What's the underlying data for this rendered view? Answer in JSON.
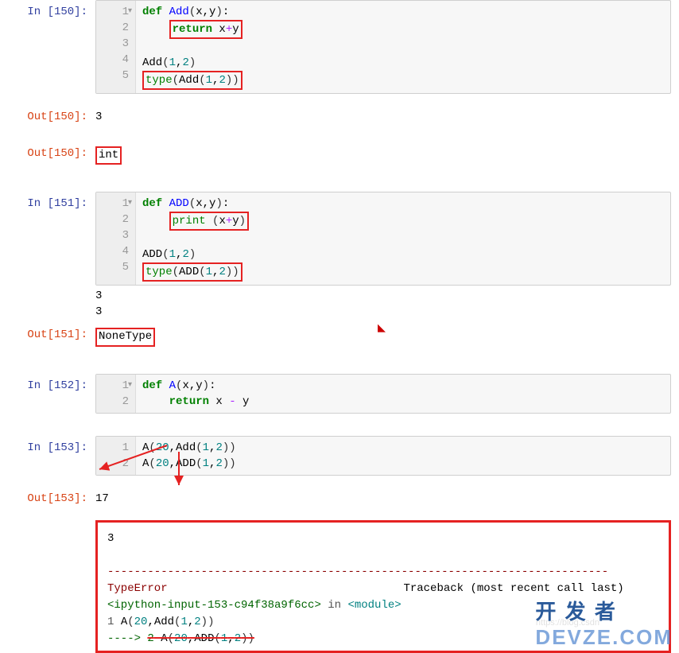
{
  "cells": {
    "c150": {
      "in_prompt": "In  [150]:",
      "gutter": [
        "1",
        "2",
        "3",
        "4",
        "5"
      ],
      "code_html_lines": [
        "<span class='kw'>def</span> <span class='fn'>Add</span><span class='paren'>(</span>x,y<span class='paren'>)</span>:",
        "    <span class='redbox'><span class='kw'>return</span> x<span class='op'>+</span>y</span>",
        "",
        "Add<span class='paren'>(</span><span class='num'>1</span>,<span class='num'>2</span><span class='paren'>)</span>",
        "<span class='redbox'><span class='builtin'>type</span><span class='paren'>(</span>Add<span class='paren'>(</span><span class='num'>1</span>,<span class='num'>2</span><span class='paren'>))</span></span>"
      ],
      "out1_prompt": "Out[150]:",
      "out1_value": "3",
      "out2_prompt": "Out[150]:",
      "out2_value": "int"
    },
    "c151": {
      "in_prompt": "In  [151]:",
      "gutter": [
        "1",
        "2",
        "3",
        "4",
        "5"
      ],
      "code_html_lines": [
        "<span class='kw'>def</span> <span class='fn'>ADD</span><span class='paren'>(</span>x,y<span class='paren'>)</span>:",
        "    <span class='redbox'><span class='builtin'>print</span> <span class='paren'>(</span>x<span class='op'>+</span>y<span class='paren'>)</span></span>",
        "",
        "ADD<span class='paren'>(</span><span class='num'>1</span>,<span class='num'>2</span><span class='paren'>)</span>",
        "<span class='redbox'><span class='builtin'>type</span><span class='paren'>(</span>ADD<span class='paren'>(</span><span class='num'>1</span>,<span class='num'>2</span><span class='paren'>))</span></span>"
      ],
      "stdout_lines": [
        "3",
        "3"
      ],
      "out_prompt": "Out[151]:",
      "out_value": "NoneType"
    },
    "c152": {
      "in_prompt": "In  [152]:",
      "gutter": [
        "1",
        "2"
      ],
      "code_html_lines": [
        "<span class='kw'>def</span> <span class='fn'>A</span><span class='paren'>(</span>x,y<span class='paren'>)</span>:",
        "    <span class='kw'>return</span> x <span class='op'>-</span> y"
      ]
    },
    "c153": {
      "in_prompt": "In  [153]:",
      "gutter": [
        "1",
        "2"
      ],
      "code_html_lines": [
        "A<span class='paren'>(</span><span class='num'>20</span>,Add<span class='paren'>(</span><span class='num'>1</span>,<span class='num'>2</span><span class='paren'>))</span>",
        "A<span class='paren'>(</span><span class='num'>20</span>,ADD<span class='paren'>(</span><span class='num'>1</span>,<span class='num'>2</span><span class='paren'>))</span>"
      ],
      "out_prompt": "Out[153]:",
      "out_value": "17"
    }
  },
  "error": {
    "stdout": "3",
    "type": "TypeError",
    "traceback_label": "Traceback (most recent call last)",
    "source": "<ipython-input-153-c94f38a9f6cc>",
    "in_label": " in ",
    "module": "<module>",
    "line1": "      1 A(20,Add(1,2))",
    "arrow_prefix": "----> ",
    "line2_num": "2",
    "line2_code": " A(20,ADD(1,2))"
  },
  "watermark": "DEVZE.COM",
  "watermark_sub": "https://blog.csdn",
  "dev_cn": "开 发 者"
}
